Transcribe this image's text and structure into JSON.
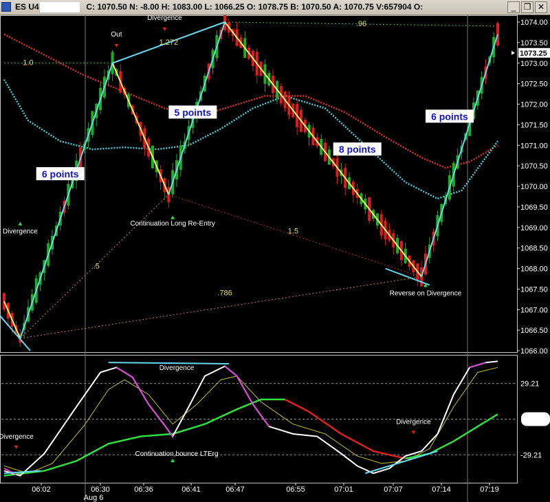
{
  "window": {
    "title": "ES U4",
    "quote": "C: 1070.50 N: -8.00 H: 1083.00 L: 1066.25 O: 1078.75 B: 1070.50 A: 1070.75 V:657904 O:",
    "minimize_glyph": "_",
    "restore_glyph": "❐",
    "close_glyph": "✕"
  },
  "colors": {
    "background": "#000000",
    "up_bar": "#1fae1f",
    "down_bar": "#e21b1b",
    "swing_up": "#66d8f0",
    "swing_down": "#f0f070",
    "ma_red": "#e03030",
    "ma_cyan": "#40d0e0",
    "osc_white": "#ffffff",
    "osc_magenta": "#e040e0",
    "osc_yellow": "#c8c020",
    "osc_green": "#30e040",
    "osc_red": "#e02020"
  },
  "chart_data": [
    {
      "type": "candlestick",
      "name": "price",
      "ylim": [
        1066.0,
        1074.0
      ],
      "y_ticks": [
        "1074.00",
        "1073.50",
        "1073.00",
        "1072.50",
        "1072.00",
        "1071.50",
        "1071.00",
        "1070.50",
        "1070.00",
        "1069.50",
        "1069.00",
        "1068.50",
        "1068.00",
        "1067.50",
        "1067.00",
        "1066.50",
        "1066.00"
      ],
      "current_price": "1073.25",
      "time_ticks": [
        "06:02",
        "06:30",
        "06:36",
        "06:41",
        "06:47",
        "06:55",
        "07:01",
        "07:07",
        "07:14",
        "07:19"
      ],
      "date_label": "Aug 6",
      "swings": [
        {
          "from": [
            0,
            1067.2
          ],
          "to": [
            4,
            1066.3
          ],
          "color": "yellow"
        },
        {
          "from": [
            4,
            1066.3
          ],
          "to": [
            27,
            1073.0
          ],
          "color": "cyan"
        },
        {
          "from": [
            27,
            1073.0
          ],
          "to": [
            41,
            1069.8
          ],
          "color": "yellow"
        },
        {
          "from": [
            41,
            1069.8
          ],
          "to": [
            55,
            1074.0
          ],
          "color": "cyan"
        },
        {
          "from": [
            55,
            1074.0
          ],
          "to": [
            104,
            1067.8
          ],
          "color": "yellow"
        },
        {
          "from": [
            104,
            1067.8
          ],
          "to": [
            123,
            1073.7
          ],
          "color": "cyan"
        }
      ],
      "annotations": [
        {
          "text": "6 points",
          "x": 14,
          "y": 1070.3,
          "boxed": true
        },
        {
          "text": "5 points",
          "x": 47,
          "y": 1071.8,
          "boxed": true
        },
        {
          "text": "8 points",
          "x": 88,
          "y": 1070.9,
          "boxed": true
        },
        {
          "text": "6 points",
          "x": 111,
          "y": 1071.7,
          "boxed": true
        },
        {
          "text": "Divergence",
          "x": 4,
          "y": 1068.85
        },
        {
          "text": "Out",
          "x": 28,
          "y": 1073.65
        },
        {
          "text": "Divergence",
          "x": 40,
          "y": 1074.05
        },
        {
          "text": "Continuation Long Re-Entry",
          "x": 42,
          "y": 1069.05
        },
        {
          "text": "Reverse on Divergence",
          "x": 105,
          "y": 1067.35
        },
        {
          "text": "1.0",
          "x": 6,
          "y": 1072.95
        },
        {
          "text": "1.272",
          "x": 41,
          "y": 1073.45
        },
        {
          "text": ".96",
          "x": 89,
          "y": 1073.9
        },
        {
          "text": "1.5",
          "x": 72,
          "y": 1068.85
        },
        {
          "text": ".5",
          "x": 23,
          "y": 1068.0
        },
        {
          "text": ".786",
          "x": 55,
          "y": 1067.35
        }
      ],
      "moving_averages": [
        {
          "name": "red",
          "points": [
            [
              0,
              1073.7
            ],
            [
              10,
              1073.2
            ],
            [
              20,
              1072.7
            ],
            [
              30,
              1072.3
            ],
            [
              40,
              1071.9
            ],
            [
              48,
              1071.7
            ],
            [
              55,
              1071.9
            ],
            [
              65,
              1072.2
            ],
            [
              75,
              1072.2
            ],
            [
              85,
              1071.8
            ],
            [
              95,
              1071.2
            ],
            [
              104,
              1070.7
            ],
            [
              110,
              1070.45
            ],
            [
              116,
              1070.6
            ],
            [
              123,
              1071.0
            ]
          ]
        },
        {
          "name": "cyan",
          "points": [
            [
              0,
              1072.6
            ],
            [
              6,
              1071.6
            ],
            [
              14,
              1071.1
            ],
            [
              22,
              1070.9
            ],
            [
              30,
              1070.95
            ],
            [
              38,
              1070.9
            ],
            [
              46,
              1071.0
            ],
            [
              54,
              1071.4
            ],
            [
              62,
              1071.9
            ],
            [
              70,
              1072.2
            ],
            [
              80,
              1071.9
            ],
            [
              90,
              1071.0
            ],
            [
              100,
              1070.1
            ],
            [
              108,
              1069.7
            ],
            [
              114,
              1069.9
            ],
            [
              123,
              1071.1
            ]
          ]
        }
      ]
    },
    {
      "type": "line",
      "name": "oscillator",
      "ylim": [
        0,
        100
      ],
      "y_ticks": [
        "29.21",
        "-29.21"
      ],
      "annotations": [
        {
          "text": "Divergence",
          "x": 43,
          "y": 90
        },
        {
          "text": "Continuation,bounce LTErg",
          "x": 43,
          "y": 20
        },
        {
          "text": "Divergence",
          "x": 3,
          "y": 34
        },
        {
          "text": "Divergence",
          "x": 102,
          "y": 46
        }
      ]
    }
  ]
}
